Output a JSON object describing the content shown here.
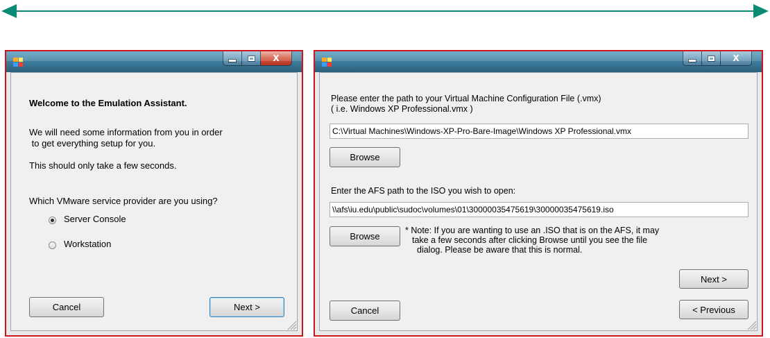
{
  "colors": {
    "arrow": "#0b8a76",
    "window_border": "#d0141c"
  },
  "left_dialog": {
    "title_icon": "app-icon",
    "welcome": "Welcome to the Emulation Assistant.",
    "info_line1": "We will need some information from you in order",
    "info_line2": " to get everything setup for you.",
    "info_line3": "This should only take a few seconds.",
    "question": "Which VMware service provider are you using?",
    "options": [
      {
        "label": "Server Console",
        "selected": true
      },
      {
        "label": "Workstation",
        "selected": false
      }
    ],
    "cancel_label": "Cancel",
    "next_label": "Next >"
  },
  "right_dialog": {
    "title_icon": "app-icon",
    "vmx_prompt_line1": "Please enter the path to your Virtual Machine Configuration File (.vmx)",
    "vmx_prompt_line2": "( i.e. Windows XP Professional.vmx )",
    "vmx_path": "C:\\Virtual Machines\\Windows-XP-Pro-Bare-Image\\Windows XP Professional.vmx",
    "browse_label_1": "Browse",
    "iso_prompt": "Enter the AFS path to the ISO you wish to open:",
    "iso_path": "\\\\afs\\iu.edu\\public\\sudoc\\volumes\\01\\30000035475619\\30000035475619.iso",
    "browse_label_2": "Browse",
    "note_line1": "* Note: If you are wanting to use an .ISO that is on the AFS, it may",
    "note_line2": "take a few seconds after clicking Browse until you see the file",
    "note_line3": "dialog. Please be aware that this is normal.",
    "next_label": "Next >",
    "cancel_label": "Cancel",
    "previous_label": "< Previous"
  }
}
